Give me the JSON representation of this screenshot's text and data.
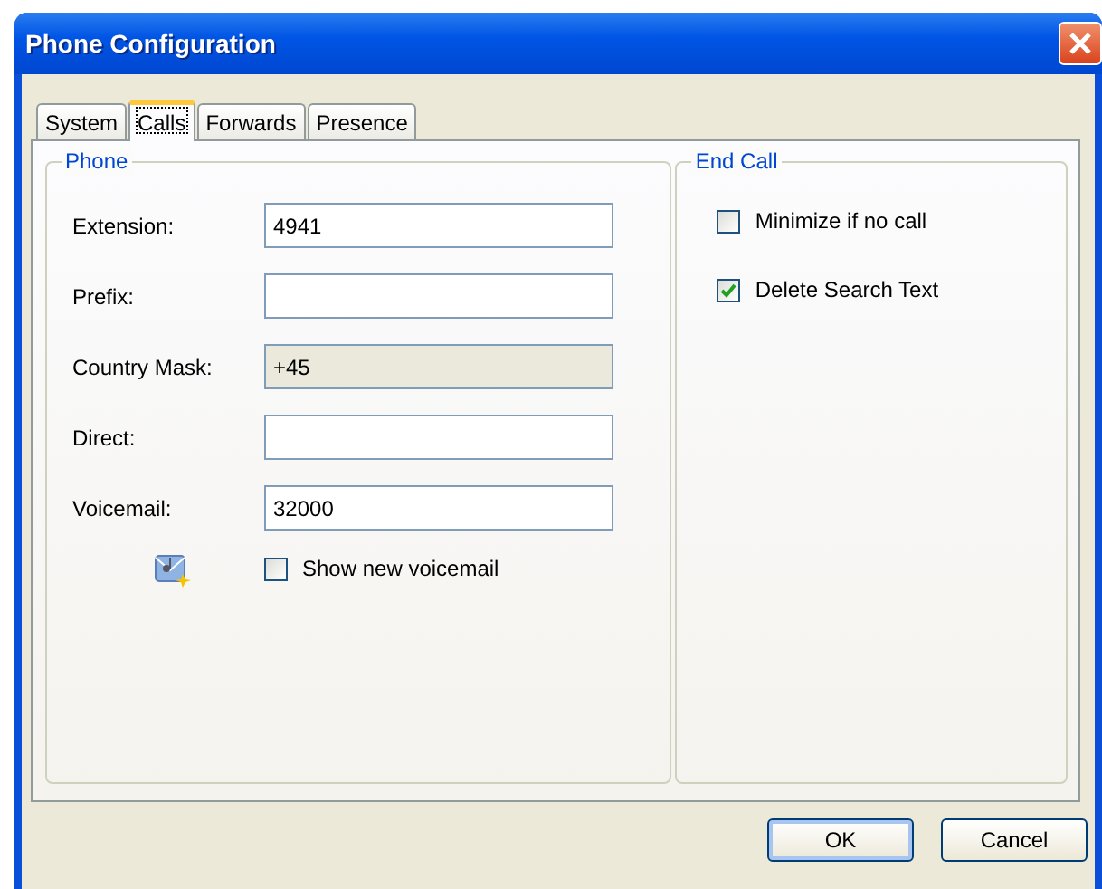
{
  "window": {
    "title": "Phone Configuration"
  },
  "tabs": [
    {
      "label": "System",
      "selected": false
    },
    {
      "label": "Calls",
      "selected": true
    },
    {
      "label": "Forwards",
      "selected": false
    },
    {
      "label": "Presence",
      "selected": false
    }
  ],
  "phone": {
    "title": "Phone",
    "fields": [
      {
        "label": "Extension:",
        "value": "4941",
        "disabled": false
      },
      {
        "label": "Prefix:",
        "disabled": false
      },
      {
        "label": "Country Mask:",
        "value": "+45",
        "disabled": true
      },
      {
        "label": "Direct:",
        "disabled": false
      },
      {
        "label": "Voicemail:",
        "value": "32000",
        "disabled": false
      }
    ],
    "voicemail_option": {
      "label": "Show new voicemail",
      "checked": false
    }
  },
  "end_call": {
    "title": "End Call",
    "options": [
      {
        "label": "Minimize if no call",
        "checked": false
      },
      {
        "label": "Delete Search Text",
        "checked": true
      }
    ]
  },
  "buttons": [
    {
      "label": "OK",
      "default": true
    },
    {
      "label": "Cancel",
      "default": false
    }
  ]
}
